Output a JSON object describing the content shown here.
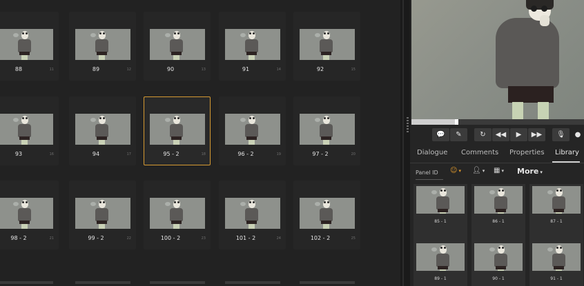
{
  "storyboard": {
    "rows": [
      [
        {
          "label": "88",
          "index": "11"
        },
        {
          "label": "89",
          "index": "12"
        },
        {
          "label": "90",
          "index": "13"
        },
        {
          "label": "91",
          "index": "14"
        },
        {
          "label": "92",
          "index": "15"
        }
      ],
      [
        {
          "label": "93",
          "index": "16"
        },
        {
          "label": "94",
          "index": "17"
        },
        {
          "label": "95 - 2",
          "index": "18",
          "selected": true
        },
        {
          "label": "96 - 2",
          "index": "19"
        },
        {
          "label": "97 - 2",
          "index": "20"
        }
      ],
      [
        {
          "label": "98 - 2",
          "index": "21"
        },
        {
          "label": "99 - 2",
          "index": "22"
        },
        {
          "label": "100 - 2",
          "index": "23"
        },
        {
          "label": "101 - 2",
          "index": "24"
        },
        {
          "label": "102 - 2",
          "index": "25"
        }
      ]
    ],
    "accent_color": "#d69a32"
  },
  "controls": [
    {
      "name": "comment-button",
      "icon": "speech-bubble-icon",
      "glyph": "💬"
    },
    {
      "name": "edit-button",
      "icon": "pencil-icon",
      "glyph": "✎"
    },
    {
      "name": "loop-button",
      "icon": "loop-icon",
      "glyph": "↻"
    },
    {
      "name": "rewind-button",
      "icon": "rewind-icon",
      "glyph": "◀◀"
    },
    {
      "name": "play-button",
      "icon": "play-icon",
      "glyph": "▶"
    },
    {
      "name": "fast-forward-button",
      "icon": "fast-forward-icon",
      "glyph": "▶▶"
    },
    {
      "name": "microphone-button",
      "icon": "microphone-icon",
      "glyph": "🎙"
    },
    {
      "name": "record-button",
      "icon": "record-icon",
      "glyph": "●"
    }
  ],
  "tabs": [
    {
      "label": "Dialogue"
    },
    {
      "label": "Comments"
    },
    {
      "label": "Properties"
    },
    {
      "label": "Library",
      "active": true
    }
  ],
  "filters": {
    "panel_id_placeholder": "Panel ID",
    "filter1_icon": "tag-icon",
    "filter2_icon": "person-icon",
    "filter3_icon": "calendar-icon",
    "more_label": "More"
  },
  "library": [
    {
      "label": "85 - 1"
    },
    {
      "label": "86 - 1"
    },
    {
      "label": "87 - 1"
    },
    {
      "label": "89 - 1"
    },
    {
      "label": "90 - 1"
    },
    {
      "label": "91 - 1"
    }
  ]
}
